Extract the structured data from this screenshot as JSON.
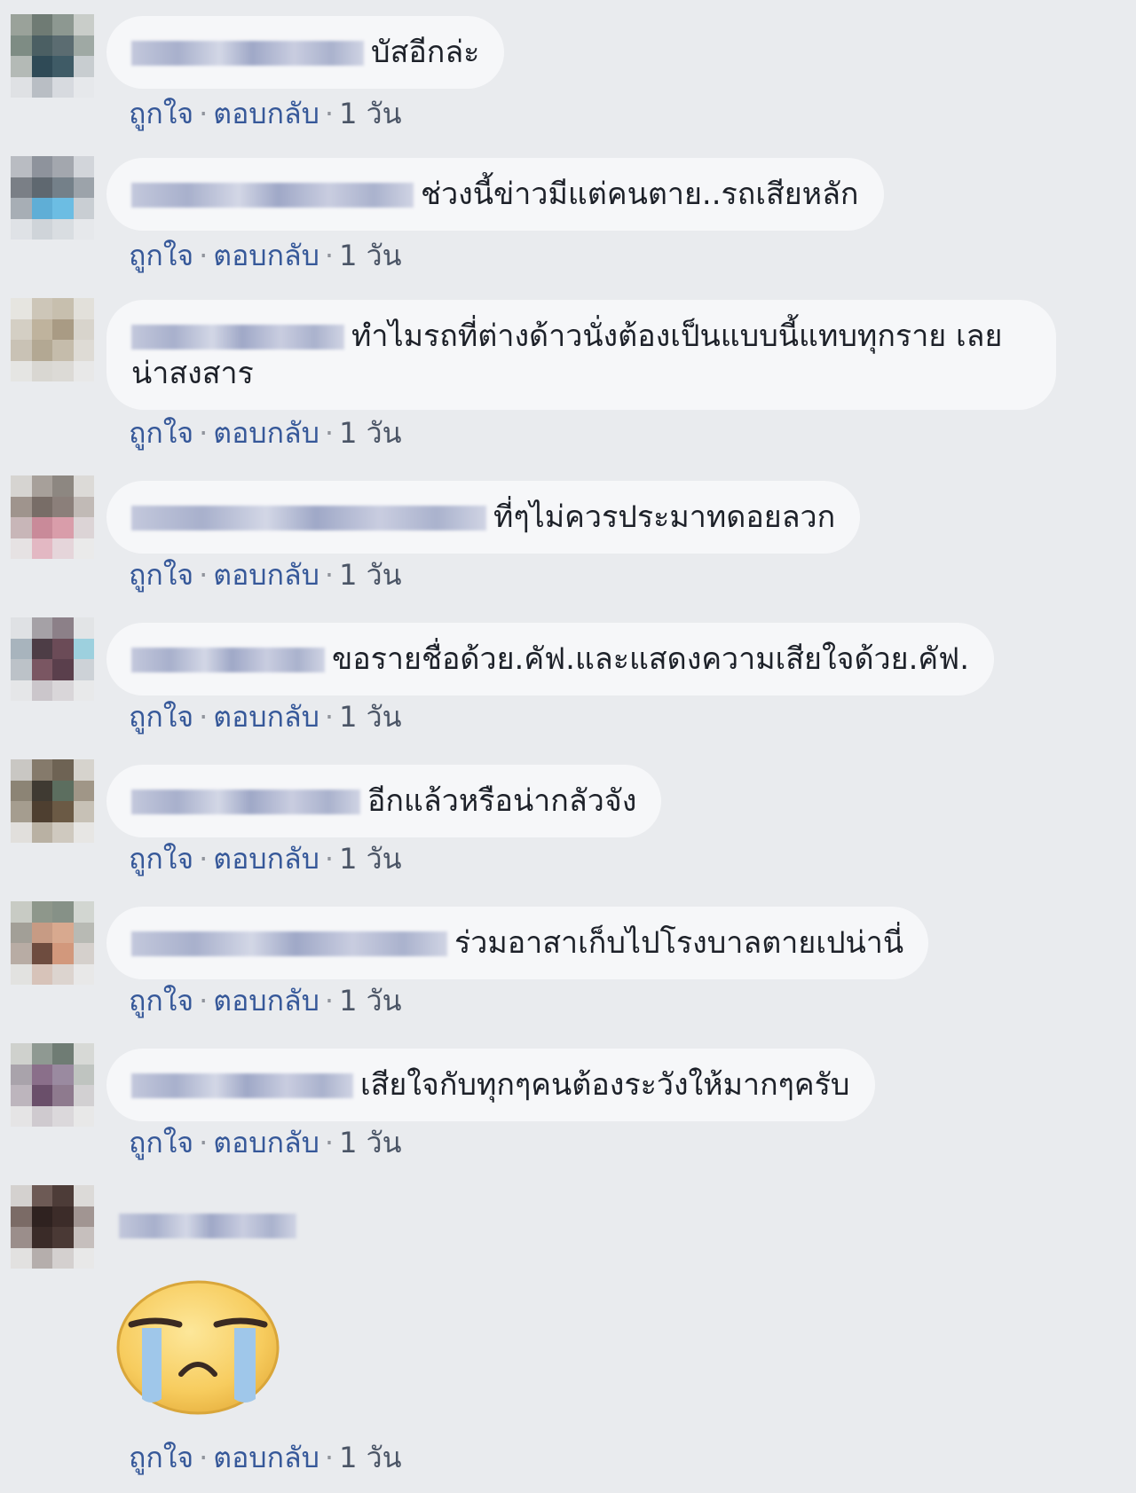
{
  "actions": {
    "like": "ถูกใจ",
    "reply": "ตอบกลับ",
    "separator": "·",
    "time": "1 วัน"
  },
  "comments": [
    {
      "text": "บัสอีกล่ะ"
    },
    {
      "text": "ช่วงนี้ข่าวมีแต่คนตาย..รถเสียหลัก"
    },
    {
      "text": "ทำไมรถที่ต่างด้าวนั่งต้องเป็นแบบนี้แทบทุกราย เลย น่าสงสาร"
    },
    {
      "text": "ที่ๆไม่ควรประมาทดอยลวก"
    },
    {
      "text": "ขอรายชื่อด้วย.คัฟ.และแสดงความเสียใจด้วย.คัฟ."
    },
    {
      "text": "อีกแล้วหรือน่ากลัวจัง"
    },
    {
      "text": "ร่วมอาสาเก็บไปโรงบาลตายเปน่านี่"
    },
    {
      "text": "เสียใจกับทุกๆคนต้องระวังให้มากๆครับ"
    }
  ],
  "sticker": {
    "icon": "crying-face-sticker",
    "color": "#f7cc5e"
  }
}
